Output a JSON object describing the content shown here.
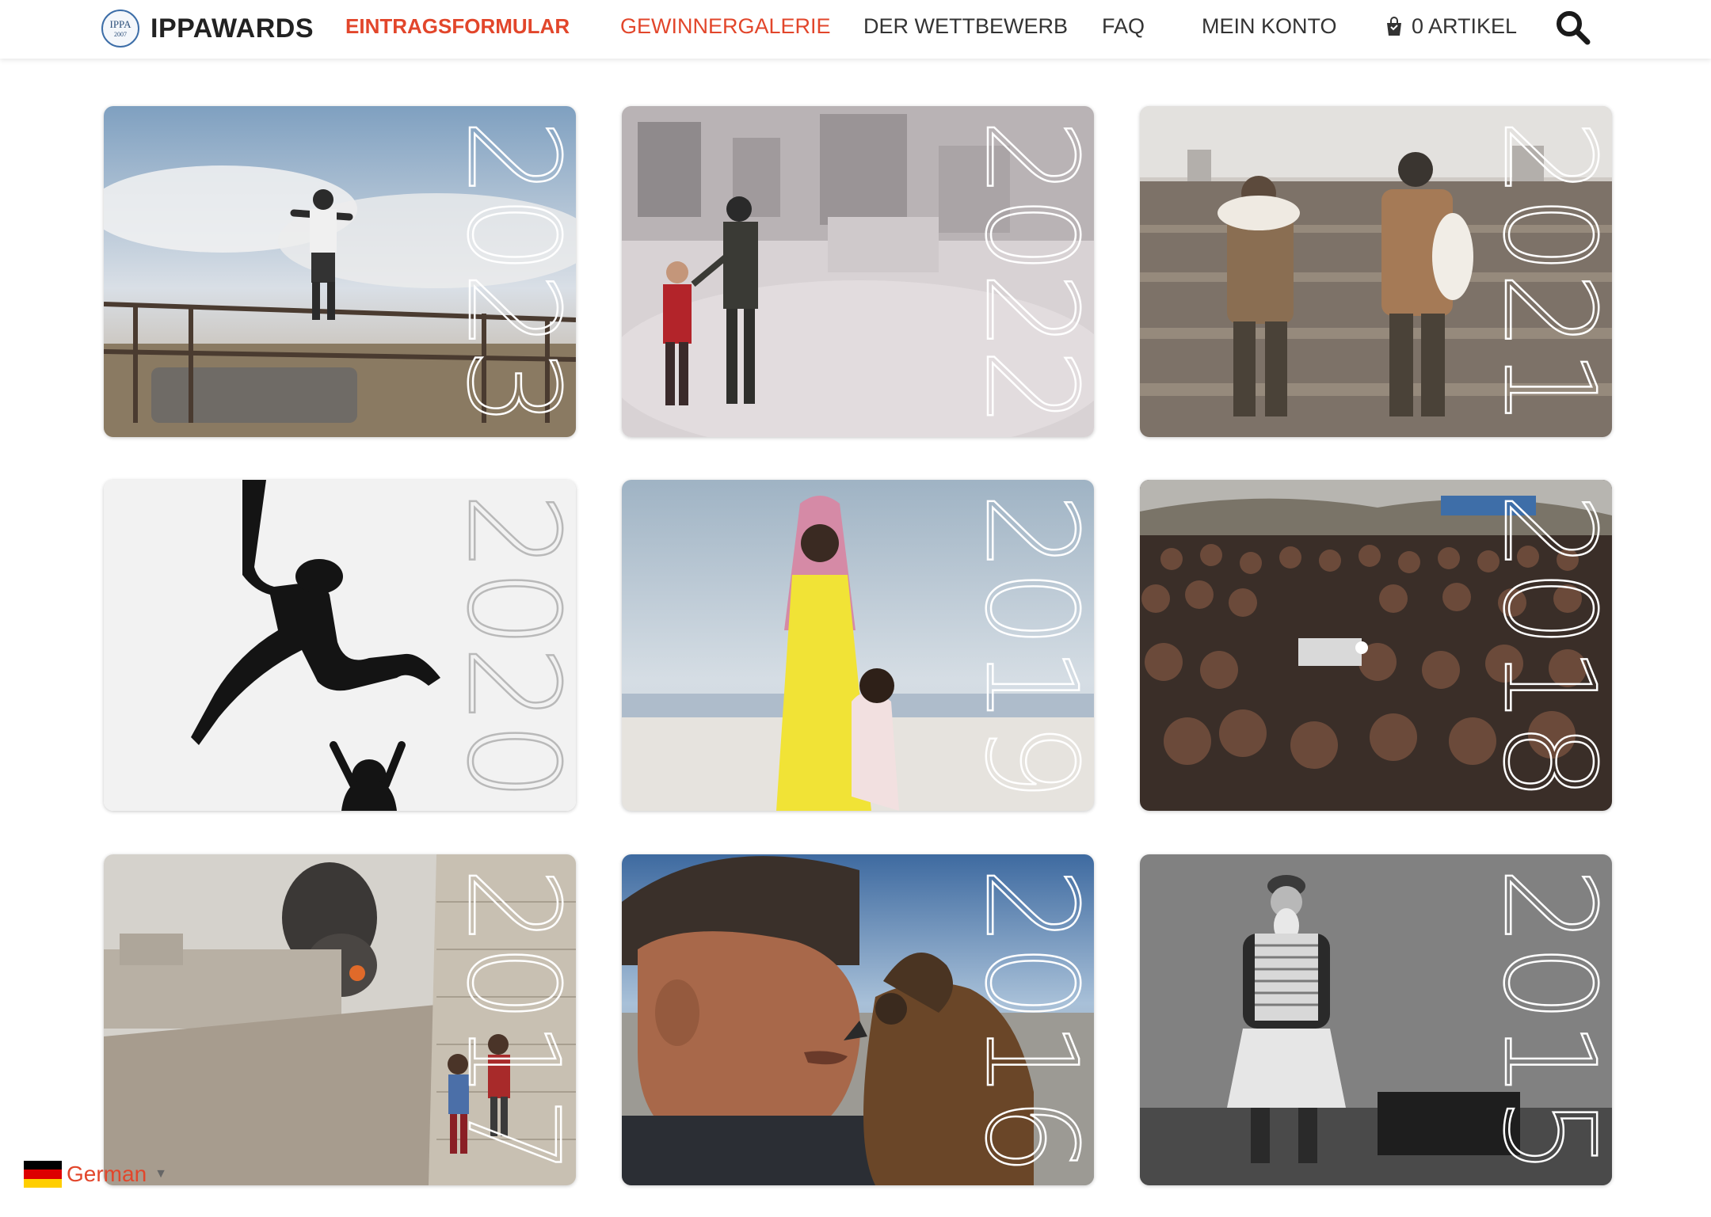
{
  "brand": {
    "logo_seal_text": "IPPA",
    "logo_seal_year": "2007",
    "name": "IPPAWARDS"
  },
  "nav": {
    "entry_form": "EINTRAGSFORMULAR",
    "gallery": "GEWINNERGALERIE",
    "contest": "DER WETTBEWERB",
    "faq": "FAQ",
    "account": "MEIN KONTO",
    "cart": "0 ARTIKEL",
    "cart_icon": "shopping-basket-icon",
    "search_icon": "search-icon"
  },
  "colors": {
    "accent": "#e2462b",
    "text": "#333333"
  },
  "gallery": {
    "cards": [
      {
        "year": "2023",
        "icon": "photo-boy-on-truck-rack"
      },
      {
        "year": "2022",
        "icon": "photo-soldier-and-boy-ruins"
      },
      {
        "year": "2021",
        "icon": "photo-shepherds-carrying-lambs"
      },
      {
        "year": "2020",
        "icon": "photo-boy-jumping-silhouette"
      },
      {
        "year": "2019",
        "icon": "photo-girl-yellow-dress-beach"
      },
      {
        "year": "2018",
        "icon": "photo-crowd-watching-projector"
      },
      {
        "year": "2017",
        "icon": "photo-children-by-wall-smoke"
      },
      {
        "year": "2016",
        "icon": "photo-man-with-eagle"
      },
      {
        "year": "2015",
        "icon": "photo-old-man-accordion"
      }
    ]
  },
  "language": {
    "label": "German",
    "flag": "german-flag-icon",
    "caret": "▼"
  }
}
